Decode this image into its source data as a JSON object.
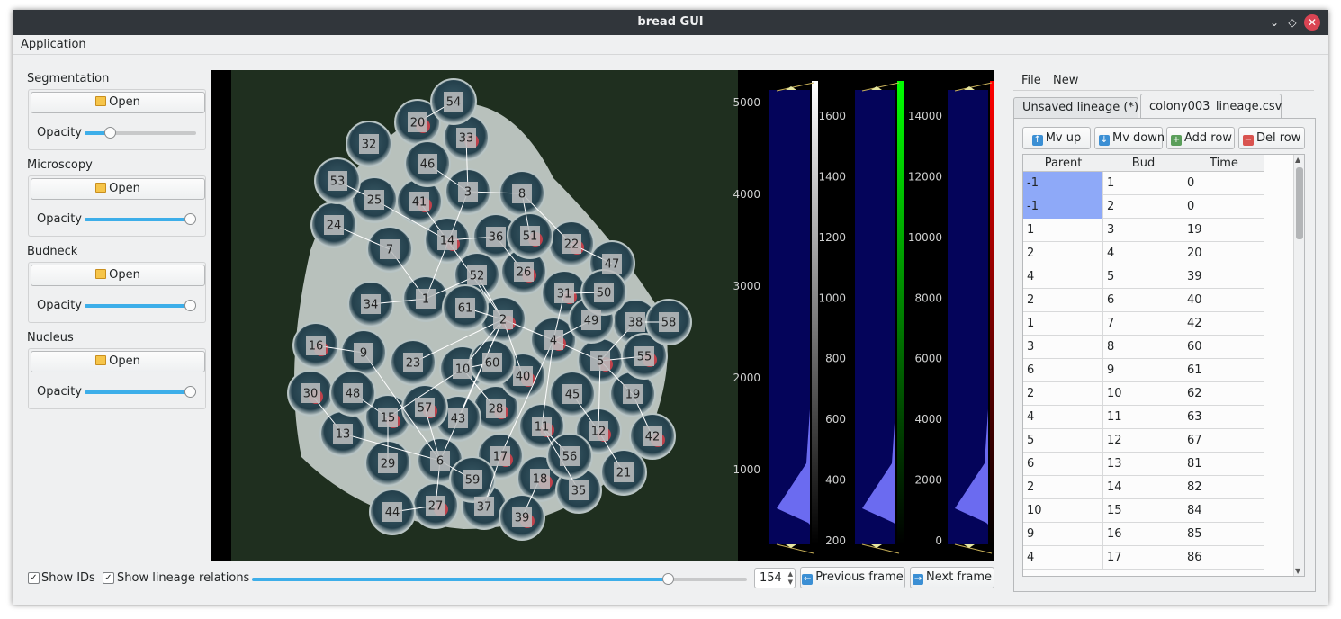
{
  "window": {
    "title": "bread GUI"
  },
  "menubar": {
    "application": "Application"
  },
  "left_panel": {
    "groups": [
      {
        "title": "Segmentation",
        "open_label": "Open",
        "opacity_label": "Opacity",
        "opacity": 0.2
      },
      {
        "title": "Microscopy",
        "open_label": "Open",
        "opacity_label": "Opacity",
        "opacity": 1.0
      },
      {
        "title": "Budneck",
        "open_label": "Open",
        "opacity_label": "Opacity",
        "opacity": 1.0
      },
      {
        "title": "Nucleus",
        "open_label": "Open",
        "opacity_label": "Opacity",
        "opacity": 1.0
      }
    ]
  },
  "viewer": {
    "cell_ids": [
      "54",
      "20",
      "32",
      "33",
      "46",
      "53",
      "3",
      "8",
      "25",
      "41",
      "24",
      "14",
      "36",
      "51",
      "22",
      "7",
      "47",
      "26",
      "52",
      "34",
      "1",
      "31",
      "50",
      "61",
      "2",
      "49",
      "38",
      "58",
      "16",
      "9",
      "4",
      "23",
      "10",
      "60",
      "5",
      "55",
      "40",
      "30",
      "48",
      "15",
      "57",
      "28",
      "45",
      "19",
      "43",
      "11",
      "13",
      "12",
      "42",
      "29",
      "6",
      "56",
      "21",
      "59",
      "17",
      "18",
      "35",
      "44",
      "27",
      "37",
      "39"
    ],
    "histograms": [
      {
        "name": "segmentation",
        "ticks": [
          "5000",
          "4000",
          "3000",
          "2000",
          "1000"
        ],
        "bar_ticks": [
          "1600",
          "1400",
          "1200",
          "1000",
          "800",
          "600",
          "400",
          "200"
        ],
        "bar_color": "#ffffff"
      },
      {
        "name": "budneck",
        "ticks": [],
        "bar_ticks": [
          "14000",
          "12000",
          "10000",
          "8000",
          "6000",
          "4000",
          "2000",
          "0"
        ],
        "bar_color": "#00ff00"
      },
      {
        "name": "nucleus",
        "ticks": [],
        "bar_ticks": [],
        "bar_color": "#ff0000"
      }
    ]
  },
  "bottom_bar": {
    "show_ids_label": "Show IDs",
    "show_ids_checked": true,
    "show_lineage_label": "Show lineage relations",
    "show_lineage_checked": true,
    "frame": "154",
    "frame_fraction": 0.85,
    "prev_label": "Previous frame",
    "next_label": "Next frame"
  },
  "right_panel": {
    "menu": {
      "file": "File",
      "new": "New"
    },
    "tabs": [
      {
        "label": "Unsaved lineage (*)",
        "active": false
      },
      {
        "label": "colony003_lineage.csv",
        "active": true
      }
    ],
    "toolbar": {
      "mv_up": "Mv up",
      "mv_down": "Mv down",
      "add_row": "Add row",
      "del_row": "Del row"
    },
    "table": {
      "columns": [
        "Parent",
        "Bud",
        "Time"
      ],
      "rows": [
        [
          "-1",
          "1",
          "0"
        ],
        [
          "-1",
          "2",
          "0"
        ],
        [
          "1",
          "3",
          "19"
        ],
        [
          "2",
          "4",
          "20"
        ],
        [
          "4",
          "5",
          "39"
        ],
        [
          "2",
          "6",
          "40"
        ],
        [
          "1",
          "7",
          "42"
        ],
        [
          "3",
          "8",
          "60"
        ],
        [
          "6",
          "9",
          "61"
        ],
        [
          "2",
          "10",
          "62"
        ],
        [
          "4",
          "11",
          "63"
        ],
        [
          "5",
          "12",
          "67"
        ],
        [
          "6",
          "13",
          "81"
        ],
        [
          "2",
          "14",
          "82"
        ],
        [
          "10",
          "15",
          "84"
        ],
        [
          "9",
          "16",
          "85"
        ],
        [
          "4",
          "17",
          "86"
        ]
      ],
      "selected_cells": [
        [
          0,
          0
        ],
        [
          1,
          0
        ]
      ]
    }
  },
  "colors": {
    "accent": "#3daee9",
    "selection": "#8ea9f8",
    "titlebar": "#31363b",
    "close": "#da4453"
  }
}
